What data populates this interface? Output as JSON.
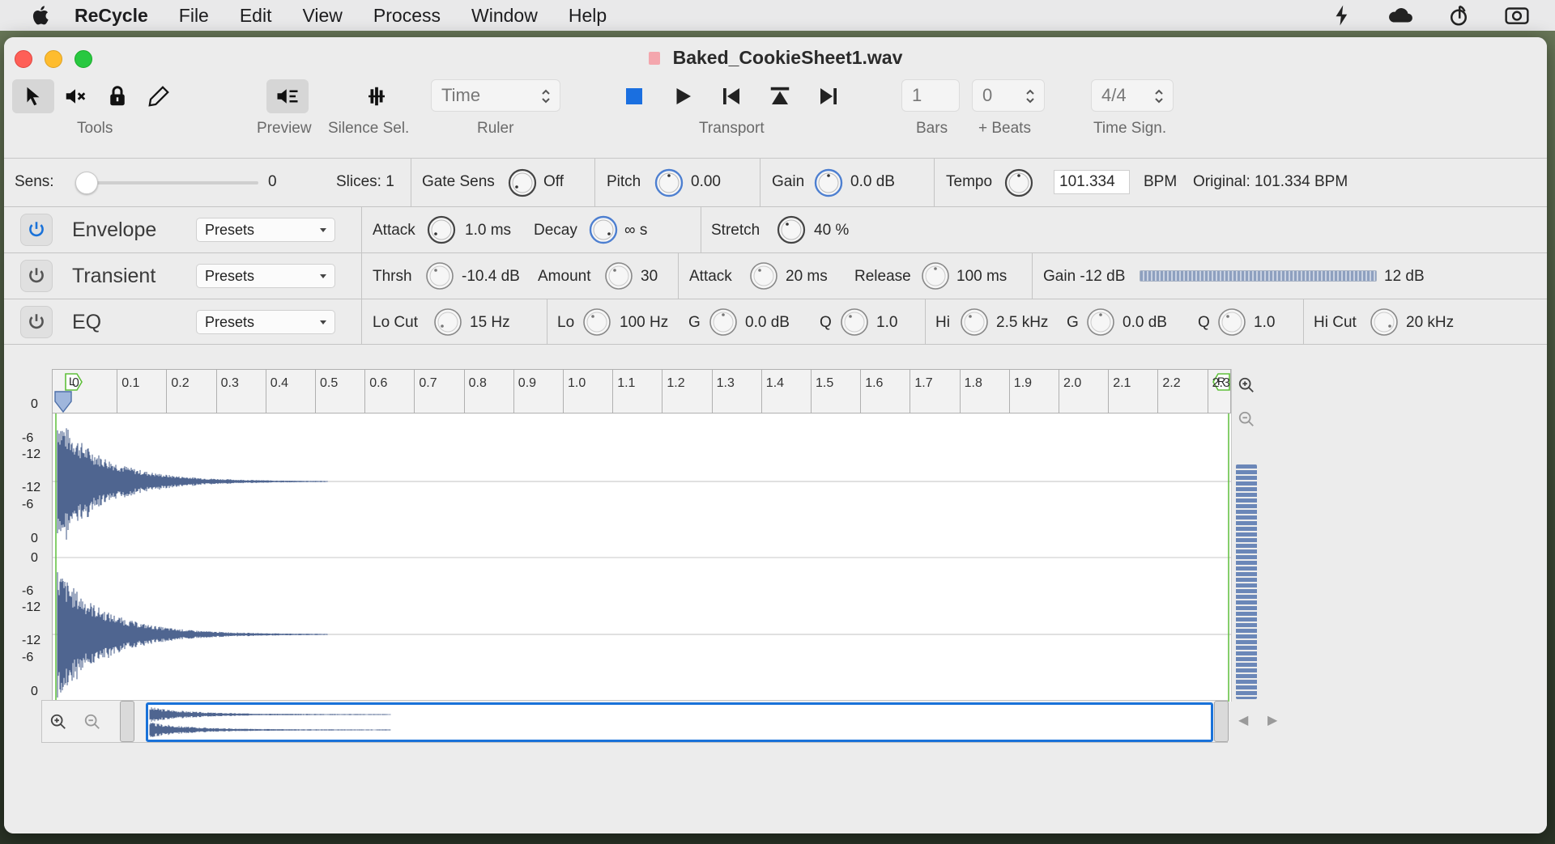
{
  "menubar": {
    "app_name": "ReCycle",
    "items": [
      "File",
      "Edit",
      "View",
      "Process",
      "Window",
      "Help"
    ],
    "status_icons": [
      "bolt-icon",
      "cloud-icon",
      "music-note-icon",
      "camera-icon"
    ]
  },
  "window": {
    "title": "Baked_CookieSheet1.wav"
  },
  "toolbar": {
    "tools_label": "Tools",
    "preview_label": "Preview",
    "silence_label": "Silence Sel.",
    "ruler_label": "Ruler",
    "ruler_value": "Time",
    "transport_label": "Transport",
    "bars_label": "Bars",
    "bars_value": "1",
    "beats_label": "+ Beats",
    "beats_value": "0",
    "timesig_label": "Time Sign.",
    "timesig_value": "4/4"
  },
  "params": {
    "sens_label": "Sens:",
    "sens_value": "0",
    "slices_label": "Slices: 1",
    "gate_label": "Gate Sens",
    "gate_value": "Off",
    "pitch_label": "Pitch",
    "pitch_value": "0.00",
    "gain_label": "Gain",
    "gain_value": "0.0 dB",
    "tempo_label": "Tempo",
    "tempo_value": "101.334",
    "bpm_label": "BPM",
    "original_label": "Original: 101.334 BPM"
  },
  "envelope": {
    "title": "Envelope",
    "presets": "Presets",
    "attack_label": "Attack",
    "attack_value": "1.0 ms",
    "decay_label": "Decay",
    "decay_value": "∞ s",
    "stretch_label": "Stretch",
    "stretch_value": "40 %"
  },
  "transient": {
    "title": "Transient",
    "presets": "Presets",
    "thrsh_label": "Thrsh",
    "thrsh_value": "-10.4 dB",
    "amount_label": "Amount",
    "amount_value": "30",
    "attack_label": "Attack",
    "attack_value": "20 ms",
    "release_label": "Release",
    "release_value": "100 ms",
    "gain_label": "Gain -12 dB",
    "gain_max": "12 dB"
  },
  "eq": {
    "title": "EQ",
    "presets": "Presets",
    "locut_label": "Lo Cut",
    "locut_value": "15 Hz",
    "lo_label": "Lo",
    "lo_value": "100 Hz",
    "lo_g_label": "G",
    "lo_g_value": "0.0 dB",
    "lo_q_label": "Q",
    "lo_q_value": "1.0",
    "hi_label": "Hi",
    "hi_value": "2.5 kHz",
    "hi_g_label": "G",
    "hi_g_value": "0.0 dB",
    "hi_q_label": "Q",
    "hi_q_value": "1.0",
    "hicut_label": "Hi Cut",
    "hicut_value": "20 kHz"
  },
  "ruler": {
    "ticks": [
      "0",
      "0.1",
      "0.2",
      "0.3",
      "0.4",
      "0.5",
      "0.6",
      "0.7",
      "0.8",
      "0.9",
      "1.0",
      "1.1",
      "1.2",
      "1.3",
      "1.4",
      "1.5",
      "1.6",
      "1.7",
      "1.8",
      "1.9",
      "2.0",
      "2.1",
      "2.2",
      "2.3"
    ],
    "left_marker": "L",
    "right_marker": "R"
  },
  "db_scale": [
    "0",
    "-6",
    "-12",
    "-12",
    "-6",
    "0",
    "0",
    "-6",
    "-12",
    "-12",
    "-6",
    "0"
  ],
  "colors": {
    "accent": "#1a72d9",
    "waveform": "#4f6590",
    "marker": "#5fbf3a"
  }
}
